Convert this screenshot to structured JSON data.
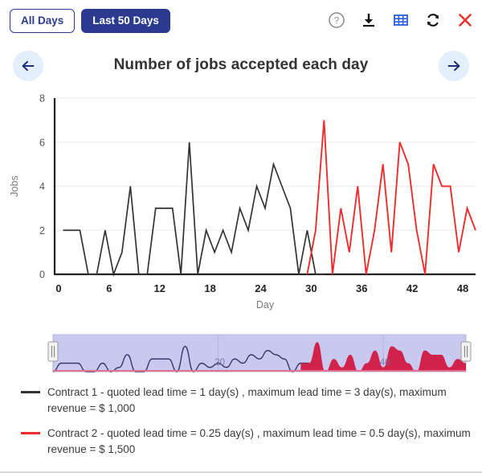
{
  "toolbar": {
    "buttons": [
      {
        "label": "All Days",
        "active": false,
        "name": "all-days-button"
      },
      {
        "label": "Last 50 Days",
        "active": true,
        "name": "last-50-days-button"
      }
    ],
    "icons": [
      {
        "name": "help-icon",
        "label": "Help"
      },
      {
        "name": "download-icon",
        "label": "Download"
      },
      {
        "name": "table-icon",
        "label": "Show table"
      },
      {
        "name": "refresh-icon",
        "label": "Refresh"
      },
      {
        "name": "close-icon",
        "label": "Close"
      }
    ],
    "colors": {
      "primary": "#2b3a8f",
      "table_icon": "#2a5edb",
      "close_icon": "#e8352d",
      "help_icon": "#808080",
      "download_icon": "#111111",
      "refresh_icon": "#111111"
    }
  },
  "navigation": {
    "prev_label": "Previous",
    "next_label": "Next",
    "arrow_color": "#1f3070",
    "circle_color": "#e3effb"
  },
  "chart_data": {
    "type": "line",
    "title": "Number of jobs accepted each day",
    "xlabel": "Day",
    "ylabel": "Jobs",
    "xlim": [
      0,
      50
    ],
    "ylim": [
      0,
      8
    ],
    "xticks": [
      0,
      6,
      12,
      18,
      24,
      30,
      36,
      42,
      48
    ],
    "yticks": [
      0,
      2,
      4,
      6,
      8
    ],
    "grid": true,
    "legend_position": "bottom",
    "series": [
      {
        "name": "Contract 1 - quoted lead time = 1 day(s) , maximum lead time = 3 day(s), maximum revenue = $ 1,000",
        "color": "#333333",
        "x": [
          1,
          2,
          3,
          4,
          5,
          6,
          7,
          8,
          9,
          10,
          11,
          12,
          13,
          14,
          15,
          16,
          17,
          18,
          19,
          20,
          21,
          22,
          23,
          24,
          25,
          26,
          27,
          28,
          29,
          30,
          31,
          32
        ],
        "values": [
          2,
          2,
          2,
          0,
          0,
          2,
          0,
          1,
          4,
          0,
          0,
          3,
          3,
          3,
          0,
          6,
          0,
          2,
          1,
          2,
          1,
          3,
          2,
          4,
          3,
          5,
          4,
          3,
          0,
          2,
          0,
          0
        ]
      },
      {
        "name": "Contract 2 - quoted lead time = 0.25 day(s) , maximum lead time = 0.5 day(s), maximum revenue = $ 1,500",
        "color": "#f02b2b",
        "x": [
          30,
          31,
          32,
          33,
          34,
          35,
          36,
          37,
          38,
          39,
          40,
          41,
          42,
          43,
          44,
          45,
          46,
          47,
          48,
          49,
          50
        ],
        "values": [
          0,
          2,
          7,
          0,
          3,
          1,
          4,
          0,
          2,
          5,
          1,
          6,
          5,
          2,
          0,
          5,
          4,
          4,
          1,
          3,
          2
        ]
      }
    ]
  },
  "navigator": {
    "left_handle": "brush-handle-left",
    "right_handle": "brush-handle-right",
    "labels": [
      "20",
      "40"
    ],
    "colors": {
      "band": "#c9c9ef",
      "line": "#343a6b",
      "selection": "#d0224b",
      "baseline": "#e27090"
    }
  },
  "legend": {
    "items": [
      {
        "color": "#333333",
        "text": "Contract 1 - quoted lead time = 1 day(s) , maximum lead time = 3 day(s), maximum revenue = $ 1,000"
      },
      {
        "color": "#f02b2b",
        "text": "Contract 2 - quoted lead time = 0.25 day(s) , maximum lead time = 0.5 day(s), maximum revenue = $ 1,500"
      }
    ]
  }
}
